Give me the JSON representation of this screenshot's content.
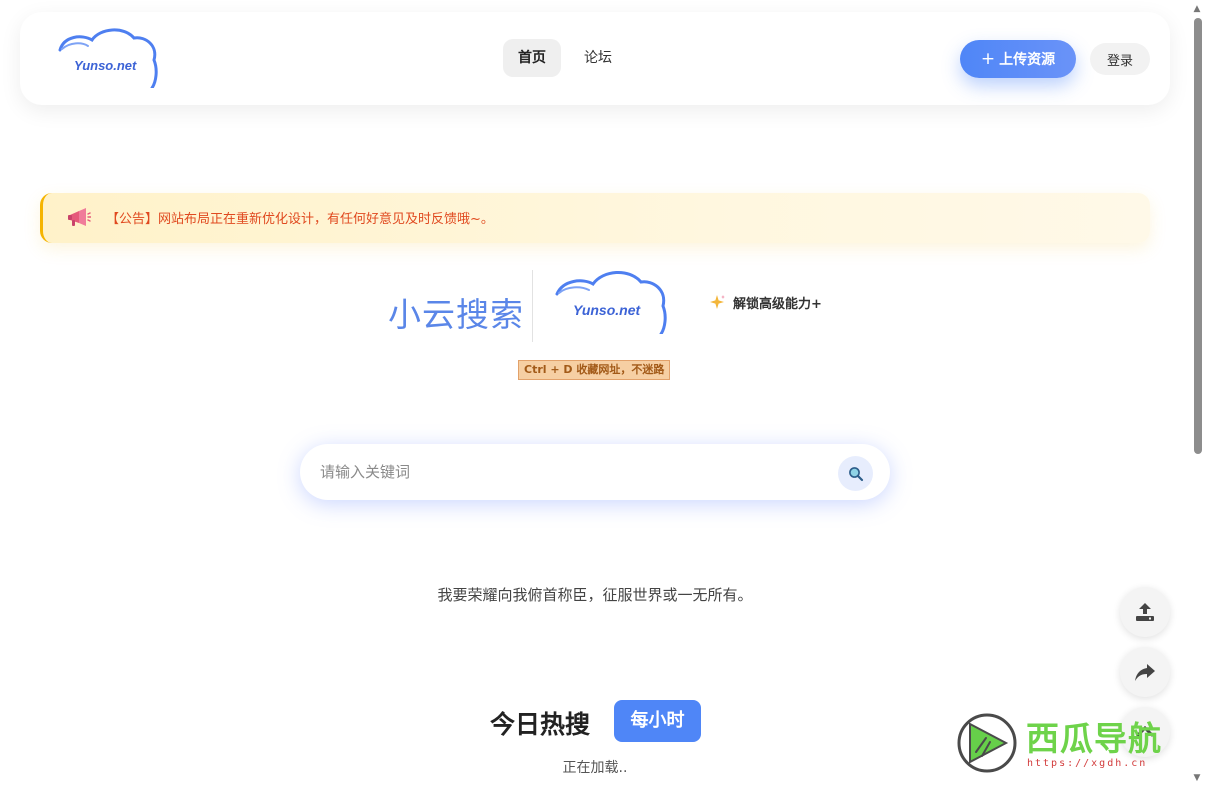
{
  "header": {
    "logo_text": "Yunso.net",
    "nav": [
      {
        "label": "首页",
        "active": true
      },
      {
        "label": "论坛",
        "active": false
      }
    ],
    "upload_label": "上传资源",
    "login_label": "登录"
  },
  "announcement": {
    "icon": "megaphone-icon",
    "text": "【公告】网站布局正在重新优化设计，有任何好意见及时反馈哦~。"
  },
  "brand": {
    "name": "小云搜索",
    "logo_text": "Yunso.net",
    "unlock_label": "解锁高级能力+",
    "bookmark_tip": "Ctrl + D 收藏网址，不迷路"
  },
  "search": {
    "placeholder": "请输入关键词",
    "value": ""
  },
  "quote": "我要荣耀向我俯首称臣，征服世界或一无所有。",
  "hot": {
    "title": "今日热搜",
    "badge": "每小时",
    "loading": "正在加载.."
  },
  "watermark": {
    "title": "西瓜导航",
    "url": "https://xgdh.cn"
  },
  "colors": {
    "accent": "#4f86f7",
    "brand_text": "#5a86e8",
    "announce_text": "#e0491f",
    "announce_border": "#f5b400"
  }
}
